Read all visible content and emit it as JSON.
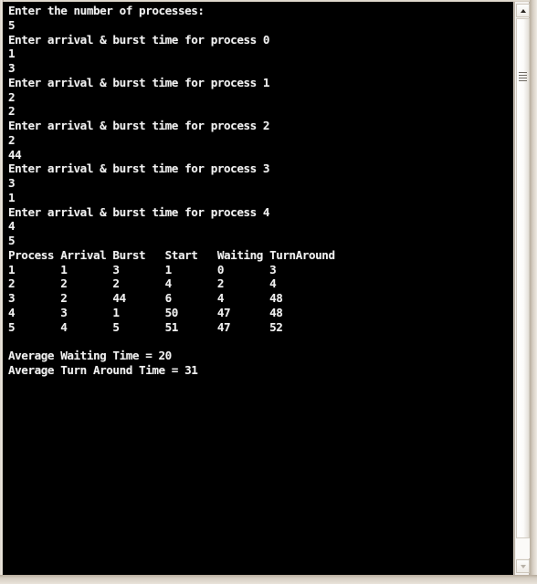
{
  "window": {
    "type": "windows-console",
    "background_color": "#000000",
    "text_color": "#f0f0f0",
    "frame_color": "#cfc6ba"
  },
  "scrollbar": {
    "up_arrow_glyph": "▲",
    "down_arrow_glyph": "▼",
    "orientation": "vertical",
    "thumb_position": "top"
  },
  "console": {
    "prompts": {
      "count_prompt": "Enter the number of processes:",
      "count_value": "5",
      "process_prompt_prefix": "Enter arrival & burst time for process"
    },
    "inputs": [
      {
        "prompt": "Enter the number of processes:",
        "value": "5"
      },
      {
        "prompt": "Enter arrival & burst time for process 0",
        "arrival": "1",
        "burst": "3"
      },
      {
        "prompt": "Enter arrival & burst time for process 1",
        "arrival": "2",
        "burst": "2"
      },
      {
        "prompt": "Enter arrival & burst time for process 2",
        "arrival": "2",
        "burst": "44"
      },
      {
        "prompt": "Enter arrival & burst time for process 3",
        "arrival": "3",
        "burst": "1"
      },
      {
        "prompt": "Enter arrival & burst time for process 4",
        "arrival": "4",
        "burst": "5"
      }
    ],
    "table": {
      "headers": [
        "Process",
        "Arrival",
        "Burst",
        "Start",
        "Waiting",
        "TurnAround"
      ],
      "rows": [
        [
          "1",
          "1",
          "3",
          "1",
          "0",
          "3"
        ],
        [
          "2",
          "2",
          "2",
          "4",
          "2",
          "4"
        ],
        [
          "3",
          "2",
          "44",
          "6",
          "4",
          "48"
        ],
        [
          "4",
          "3",
          "1",
          "50",
          "47",
          "48"
        ],
        [
          "5",
          "4",
          "5",
          "51",
          "47",
          "52"
        ]
      ]
    },
    "summary": {
      "average_waiting_label": "Average Waiting Time =",
      "average_waiting_value": "20",
      "average_turnaround_label": "Average Turn Around Time =",
      "average_turnaround_value": "31"
    },
    "full_text": "Enter the number of processes:\n5\nEnter arrival & burst time for process 0\n1\n3\nEnter arrival & burst time for process 1\n2\n2\nEnter arrival & burst time for process 2\n2\n44\nEnter arrival & burst time for process 3\n3\n1\nEnter arrival & burst time for process 4\n4\n5\nProcess Arrival Burst   Start   Waiting TurnAround\n1       1       3       1       0       3\n2       2       2       4       2       4\n3       2       44      6       4       48\n4       3       1       50      47      48\n5       4       5       51      47      52\n\nAverage Waiting Time = 20\nAverage Turn Around Time = 31"
  }
}
